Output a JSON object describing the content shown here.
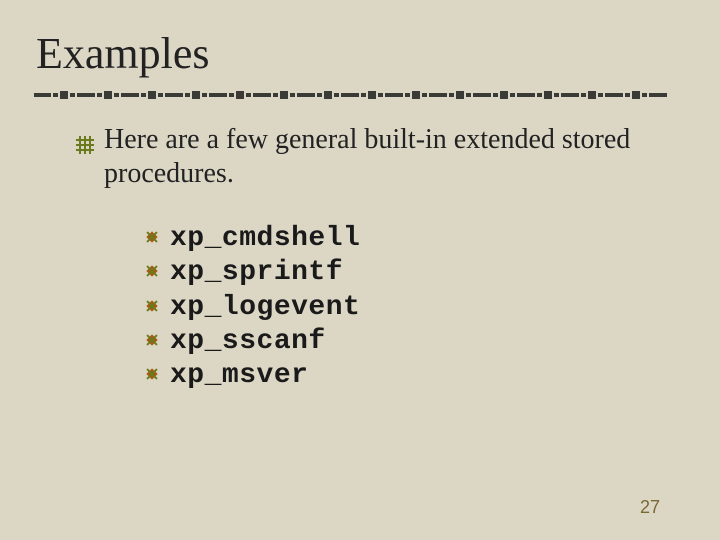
{
  "title": "Examples",
  "body_text": "Here are a few general built-in extended stored procedures.",
  "procedures": [
    "xp_cmdshell",
    "xp_sprintf",
    "xp_logevent",
    "xp_sscanf",
    "xp_msver"
  ],
  "page_number": "27",
  "colors": {
    "bullet_olive": "#6a7a1c",
    "bullet_burnt": "#a85a14",
    "rule_dark": "#3a3a36"
  }
}
